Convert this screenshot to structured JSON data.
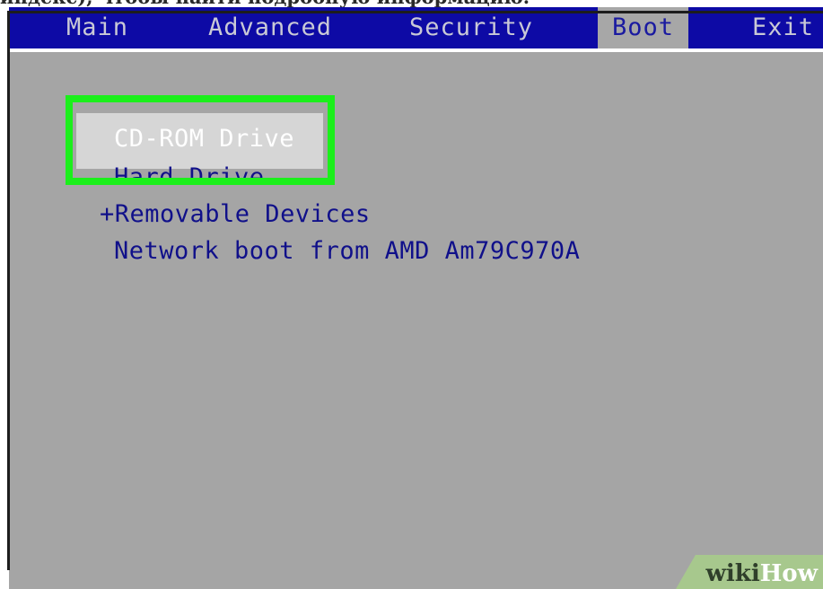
{
  "caption": "индекс), чтобы найти подробную информацию.",
  "menu": {
    "tabs": [
      {
        "label": "Main"
      },
      {
        "label": "Advanced"
      },
      {
        "label": "Security"
      },
      {
        "label": "Boot"
      },
      {
        "label": "Exit"
      }
    ],
    "active": "Boot"
  },
  "boot_order": [
    {
      "label": "CD-ROM Drive",
      "selected": true
    },
    {
      "label": "Hard Drive",
      "selected": false
    },
    {
      "label": "+Removable Devices",
      "selected": false
    },
    {
      "label": "Network boot from AMD Am79C970A",
      "selected": false
    }
  ],
  "watermark": {
    "part1": "wiki",
    "part2": "How"
  },
  "colors": {
    "menubar": "#0d0aa5",
    "panel": "#a5a5a5",
    "item_text": "#10108a",
    "highlight": "#1bef1b"
  }
}
